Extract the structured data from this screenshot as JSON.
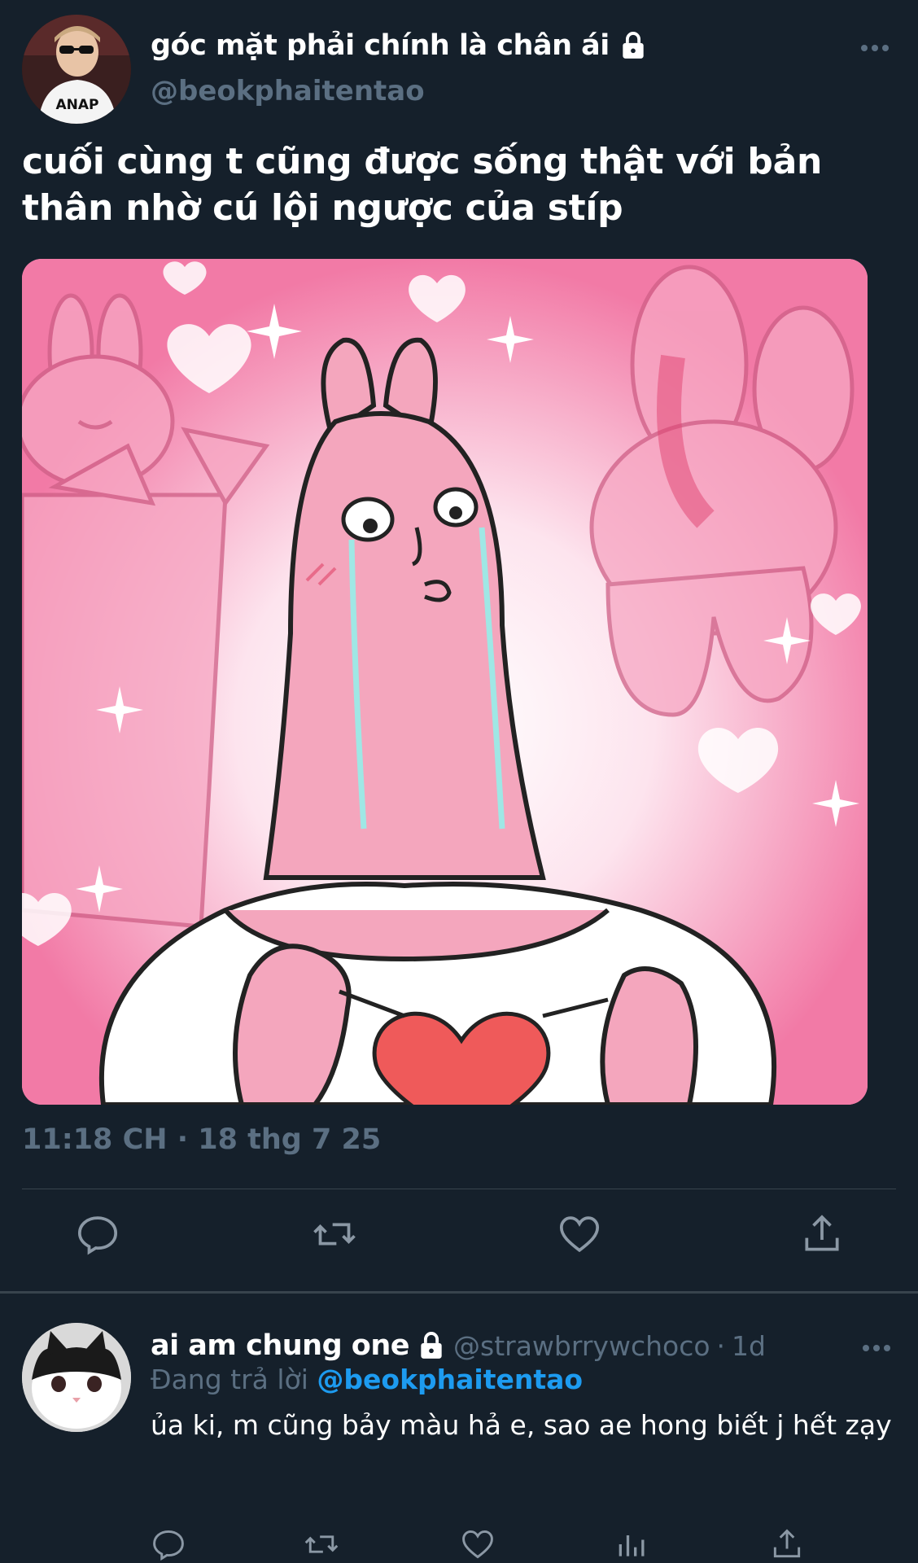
{
  "tweet": {
    "display_name": "góc mặt phải chính là chân ái",
    "handle": "@beokphaitentao",
    "text": "cuối cùng t cũng được sống thật với bản thân nhờ cú lội ngược của stíp",
    "timestamp": "11:18 CH · 18 thg 7 25",
    "avatar_text": "ANAP"
  },
  "actions": [
    "reply-icon",
    "retweet-icon",
    "like-icon",
    "share-icon"
  ],
  "reply": {
    "display_name": "ai am chung one",
    "handle": "@strawbrrywchoco",
    "dot": "·",
    "time": "1d",
    "replying_label": "Đang trả lời",
    "replying_handle": "@beokphaitentao",
    "text": "ủa ki, m cũng bảy màu hả e, sao ae hong biết j hết zạy"
  },
  "reply_actions": [
    "reply-icon",
    "retweet-icon",
    "like-icon",
    "analytics-icon",
    "share-icon"
  ],
  "colors": {
    "background": "#15202b",
    "secondary_text": "#5b6f82",
    "accent": "#1d9bf0",
    "divider": "#38444d"
  }
}
